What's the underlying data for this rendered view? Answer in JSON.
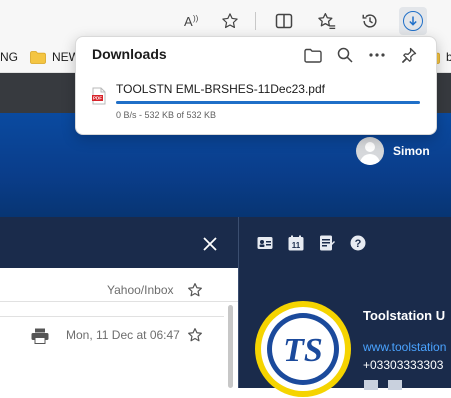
{
  "browser": {
    "toolbar_buttons": [
      "read-aloud-icon",
      "favorite-star-icon",
      "split-screen-icon",
      "favorites-icon",
      "history-icon",
      "downloads-icon"
    ]
  },
  "favorites_bar": {
    "items": [
      {
        "label": "NG",
        "icon": "none"
      },
      {
        "label": "NEW",
        "icon": "folder-icon"
      },
      {
        "label": "brick",
        "icon": "folder-icon"
      }
    ]
  },
  "downloads": {
    "title": "Downloads",
    "actions": [
      "open-folder-icon",
      "search-icon",
      "more-icon",
      "pin-icon"
    ],
    "item": {
      "filename": "TOOLSTN EML-BRSHES-11Dec23.pdf",
      "status": "0 B/s - 532 KB of 532 KB",
      "progress_fraction": 1.0,
      "icon": "pdf-icon"
    }
  },
  "account": {
    "name": "Simon"
  },
  "message": {
    "folder": "Yahoo/Inbox",
    "date": "Mon, 11 Dec at 06:47"
  },
  "sender_card": {
    "logo_text": "TS",
    "company": "Toolstation U",
    "website": "www.toolstation",
    "phone": "+03303333303"
  },
  "colors": {
    "accent": "#1f6fc8",
    "page_header": "#0a3d8a",
    "panel_dark": "#1a2b4b",
    "logo_yellow": "#f5d400",
    "logo_red": "#d8232a",
    "logo_blue": "#1b4a9c"
  }
}
